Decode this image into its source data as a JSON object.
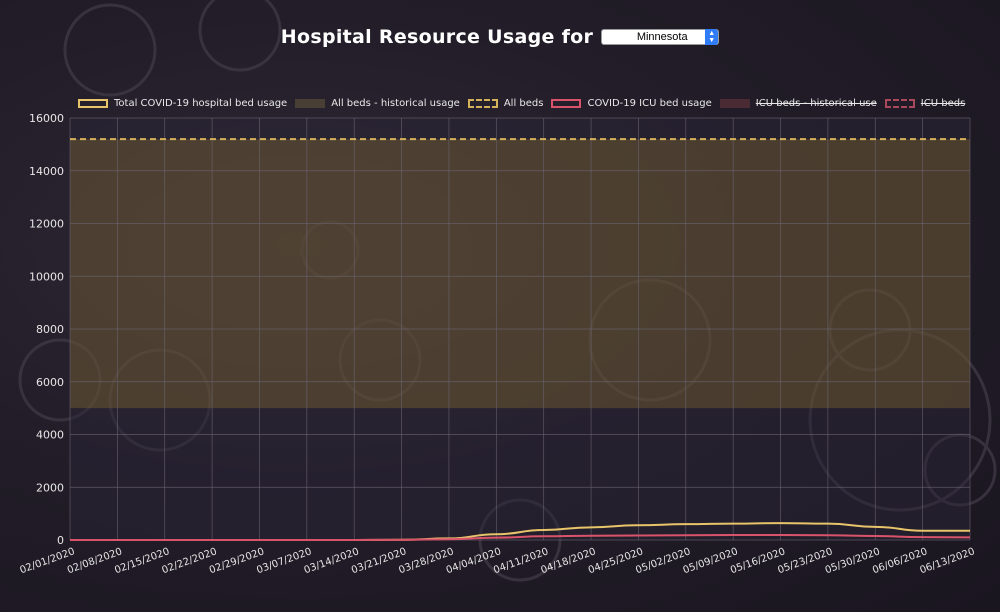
{
  "header": {
    "title": "Hospital Resource Usage for",
    "state_selected": "Minnesota"
  },
  "legend": [
    {
      "label": "Total COVID-19 hospital bed usage",
      "style": "solid-outline",
      "color": "#e8c46a",
      "hidden": false
    },
    {
      "label": "All beds - historical usage",
      "style": "fill",
      "color": "#4a3f35",
      "hidden": false
    },
    {
      "label": "All beds",
      "style": "dashed",
      "color": "#d6b25a",
      "hidden": false
    },
    {
      "label": "COVID-19 ICU bed usage",
      "style": "solid-outline",
      "color": "#d9546a",
      "hidden": false
    },
    {
      "label": "ICU beds - historical use",
      "style": "fill",
      "color": "#4a2a33",
      "hidden": true
    },
    {
      "label": "ICU beds",
      "style": "dashed",
      "color": "#a8495c",
      "hidden": true
    }
  ],
  "chart_data": {
    "type": "line",
    "categories": [
      "02/01/2020",
      "02/08/2020",
      "02/15/2020",
      "02/22/2020",
      "02/29/2020",
      "03/07/2020",
      "03/14/2020",
      "03/21/2020",
      "03/28/2020",
      "04/04/2020",
      "04/11/2020",
      "04/18/2020",
      "04/25/2020",
      "05/02/2020",
      "05/09/2020",
      "05/16/2020",
      "05/23/2020",
      "05/30/2020",
      "06/06/2020",
      "06/13/2020"
    ],
    "ylim": [
      0,
      16000
    ],
    "yticks": [
      0,
      2000,
      4000,
      6000,
      8000,
      10000,
      12000,
      14000,
      16000
    ],
    "grid": true,
    "legend_position": "top",
    "series": [
      {
        "name": "Total COVID-19 hospital bed usage",
        "values": [
          0,
          0,
          0,
          0,
          0,
          0,
          0,
          10,
          60,
          220,
          380,
          480,
          560,
          600,
          620,
          640,
          620,
          500,
          350,
          350
        ],
        "color": "#e8c46a"
      },
      {
        "name": "COVID-19 ICU bed usage",
        "values": [
          0,
          0,
          0,
          0,
          0,
          0,
          0,
          5,
          30,
          90,
          140,
          160,
          170,
          180,
          190,
          190,
          180,
          150,
          110,
          100
        ],
        "color": "#d9546a"
      }
    ],
    "bands": [
      {
        "name": "All beds - historical usage",
        "from": 5000,
        "to": 15200,
        "color": "#8a6e32"
      }
    ],
    "reference_lines": [
      {
        "name": "All beds",
        "value": 15200,
        "color": "#d6b25a"
      }
    ]
  }
}
